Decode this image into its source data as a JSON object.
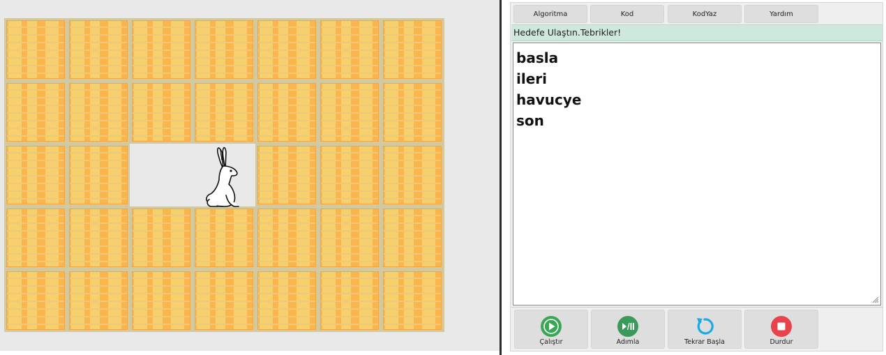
{
  "tabs": [
    "Algoritma",
    "Kod",
    "KodYaz",
    "Yardım"
  ],
  "status_message": "Hedefe Ulaştın.Tebrikler!",
  "code_lines": [
    "basla",
    "ileri",
    "havucye",
    "son"
  ],
  "controls": {
    "run": "Çalıştır",
    "step": "Adımla",
    "restart": "Tekrar Başla",
    "stop": "Durdur"
  },
  "board": {
    "rows": 5,
    "cols": 7,
    "open_row": 3,
    "open_cols": [
      3,
      4
    ],
    "character": "rabbit-icon"
  },
  "colors": {
    "status_bg": "#cfe8dc",
    "run_icon": "#3aa757",
    "step_icon": "#3a9a5a",
    "restart_icon": "#1ea8e6",
    "stop_icon": "#e8424a",
    "wall": "#fbb54d"
  }
}
